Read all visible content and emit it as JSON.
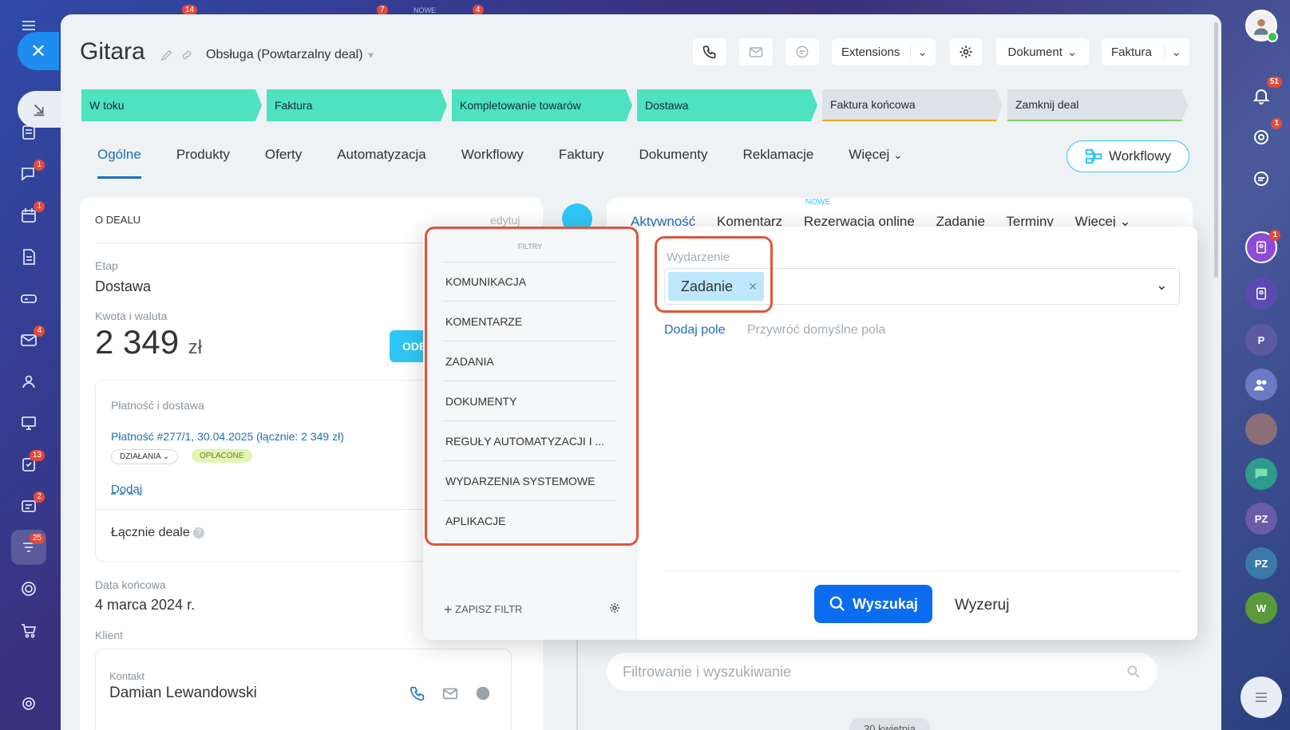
{
  "left_rail": {
    "badges": {
      "chat": "1",
      "calendar": "1",
      "mail": "4",
      "tasks": "13",
      "news": "2",
      "crm": "25"
    }
  },
  "top_faint": {
    "badge_a": "14",
    "badge_b": "7",
    "nowe": "NOWE",
    "badge_c": "4"
  },
  "right_rail": {
    "notif_badge": "51",
    "target_badge": "1",
    "user_badge": "1",
    "avatars": {
      "p": "P",
      "pz1": "PZ",
      "pz2": "PZ",
      "w": "W"
    }
  },
  "header": {
    "title": "Gitara",
    "subtitle": "Obsługa (Powtarzalny deal)",
    "extensions": "Extensions",
    "dokument": "Dokument",
    "faktura": "Faktura"
  },
  "stages": [
    {
      "label": "W toku",
      "status": "done"
    },
    {
      "label": "Faktura",
      "status": "done"
    },
    {
      "label": "Kompletowanie towarów",
      "status": "done"
    },
    {
      "label": "Dostawa",
      "status": "done"
    },
    {
      "label": "Faktura końcowa",
      "status": "todo",
      "color": "#f5a623"
    },
    {
      "label": "Zamknij deal",
      "status": "todo",
      "color": "#7fd16b"
    }
  ],
  "tabs": [
    "Ogólne",
    "Produkty",
    "Oferty",
    "Automatyzacja",
    "Workflowy",
    "Faktury",
    "Dokumenty",
    "Reklamacje",
    "Więcej"
  ],
  "workflow_button": "Workflowy",
  "deal": {
    "section_title": "O DEALU",
    "edit": "edytuj",
    "stage_label": "Etap",
    "stage_value": "Dostawa",
    "amount_label": "Kwota i waluta",
    "amount_value": "2 349",
    "currency": "zł",
    "payment_button": "ODE",
    "payment_section": "Płatność i dostawa",
    "payment_link": "Płatność #277/1, 30.04.2025 (łącznie: 2 349 zł)",
    "actions_pill": "DZIAŁANIA",
    "paid_pill": "OPŁACONE",
    "add": "Dodaj",
    "total_deals": "Łącznie deale",
    "end_date_label": "Data końcowa",
    "end_date_value": "4 marca 2024 r.",
    "client_label": "Klient",
    "contact_label": "Kontakt",
    "contact_name": "Damian Lewandowski"
  },
  "timeline_tabs": {
    "activity": "Aktywność",
    "comment": "Komentarz",
    "booking_new": "NOWE",
    "booking": "Rezerwacja online",
    "task": "Zadanie",
    "deadlines": "Terminy",
    "more": "Więcej"
  },
  "filter": {
    "heading": "FILTRY",
    "items": [
      "KOMUNIKACJA",
      "KOMENTARZE",
      "ZADANIA",
      "DOKUMENTY",
      "REGUŁY AUTOMATYZACJI I ...",
      "WYDARZENIA SYSTEMOWE",
      "APLIKACJE"
    ],
    "save_filter": "ZAPISZ FILTR",
    "field_label": "Wydarzenie",
    "field_chip": "Zadanie",
    "add_field": "Dodaj pole",
    "restore_defaults": "Przywróć domyślne pola",
    "search": "Wyszukaj",
    "reset": "Wyzeruj"
  },
  "search_bar": {
    "placeholder": "Filtrowanie i wyszukiwanie"
  },
  "date_chip": "30 kwietnia"
}
